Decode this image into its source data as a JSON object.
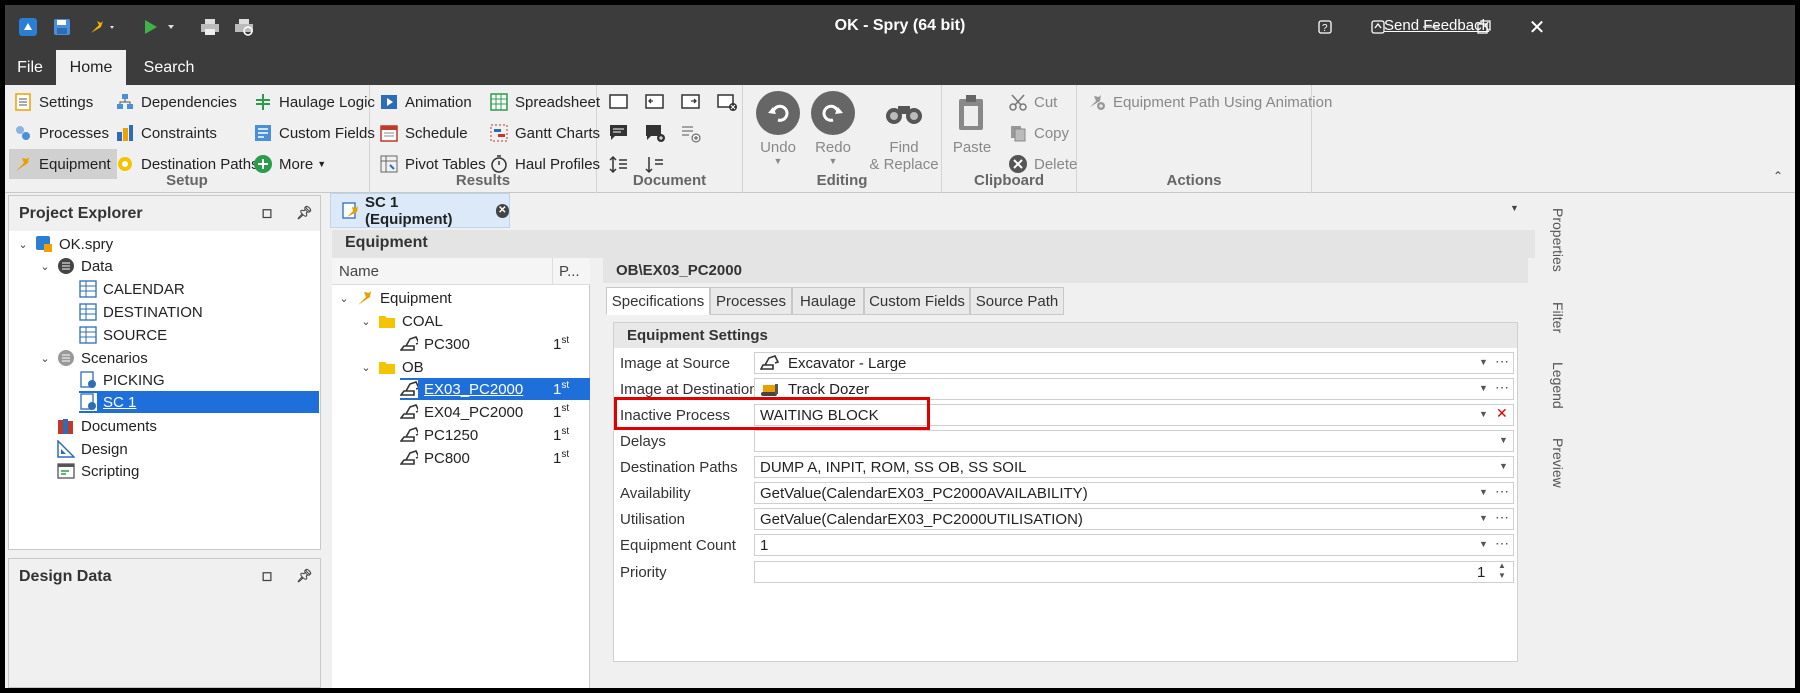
{
  "window": {
    "title": "OK - Spry (64 bit)",
    "feedback": "Send Feedback"
  },
  "tabs": {
    "file": "File",
    "home": "Home",
    "search": "Search"
  },
  "ribbon": {
    "setup": {
      "label": "Setup",
      "settings": "Settings",
      "processes": "Processes",
      "equipment": "Equipment",
      "dependencies": "Dependencies",
      "constraints": "Constraints",
      "destination_paths": "Destination Paths",
      "haulage_logic": "Haulage Logic",
      "custom_fields": "Custom Fields",
      "more": "More"
    },
    "results": {
      "label": "Results",
      "animation": "Animation",
      "schedule": "Schedule",
      "pivot_tables": "Pivot Tables",
      "spreadsheet": "Spreadsheet",
      "gantt_charts": "Gantt Charts",
      "haul_profiles": "Haul Profiles"
    },
    "document": {
      "label": "Document"
    },
    "editing": {
      "label": "Editing",
      "undo": "Undo",
      "redo": "Redo",
      "find": "Find",
      "replace": "& Replace"
    },
    "clipboard": {
      "label": "Clipboard",
      "paste": "Paste",
      "cut": "Cut",
      "copy": "Copy",
      "delete": "Delete"
    },
    "actions": {
      "label": "Actions",
      "equipment_path": "Equipment Path Using Animation"
    }
  },
  "project_explorer": {
    "title": "Project Explorer",
    "root": "OK.spry",
    "data": "Data",
    "calendar": "CALENDAR",
    "destination": "DESTINATION",
    "source": "SOURCE",
    "scenarios": "Scenarios",
    "picking": "PICKING",
    "sc1": "SC 1",
    "documents": "Documents",
    "design": "Design",
    "scripting": "Scripting"
  },
  "design_data": {
    "title": "Design Data"
  },
  "doc_tab": {
    "label": "SC 1 (Equipment)"
  },
  "equipment_panel": {
    "title": "Equipment",
    "col_name": "Name",
    "col_p": "P...",
    "root": "Equipment",
    "coal": "COAL",
    "ob": "OB"
  },
  "equipment_items": [
    {
      "name": "PC300",
      "priority": "1",
      "sup": "st"
    },
    {
      "name": "EX03_PC2000",
      "priority": "1",
      "sup": "st"
    },
    {
      "name": "EX04_PC2000",
      "priority": "1",
      "sup": "st"
    },
    {
      "name": "PC1250",
      "priority": "1",
      "sup": "st"
    },
    {
      "name": "PC800",
      "priority": "1",
      "sup": "st"
    }
  ],
  "detail": {
    "path": "OB\\EX03_PC2000",
    "tabs": [
      "Specifications",
      "Processes",
      "Haulage",
      "Custom Fields",
      "Source Path"
    ],
    "section": "Equipment Settings",
    "props": [
      {
        "label": "Image at Source",
        "value": "Excavator - Large"
      },
      {
        "label": "Image at Destination",
        "value": "Track Dozer"
      },
      {
        "label": "Inactive Process",
        "value": "WAITING BLOCK"
      },
      {
        "label": "Delays",
        "value": ""
      },
      {
        "label": "Destination Paths",
        "value": "DUMP A, INPIT, ROM, SS OB, SS SOIL"
      },
      {
        "label": "Availability",
        "value": "GetValue(CalendarEX03_PC2000AVAILABILITY)"
      },
      {
        "label": "Utilisation",
        "value": "GetValue(CalendarEX03_PC2000UTILISATION)"
      },
      {
        "label": "Equipment Count",
        "value": "1"
      },
      {
        "label": "Priority",
        "value": "1"
      }
    ]
  },
  "side_tabs": {
    "properties": "Properties",
    "filter": "Filter",
    "legend": "Legend",
    "preview": "Preview"
  },
  "colors": {
    "accent": "#1e6fd9",
    "highlight": "#e00000",
    "titlebar": "#3c3c3c"
  }
}
